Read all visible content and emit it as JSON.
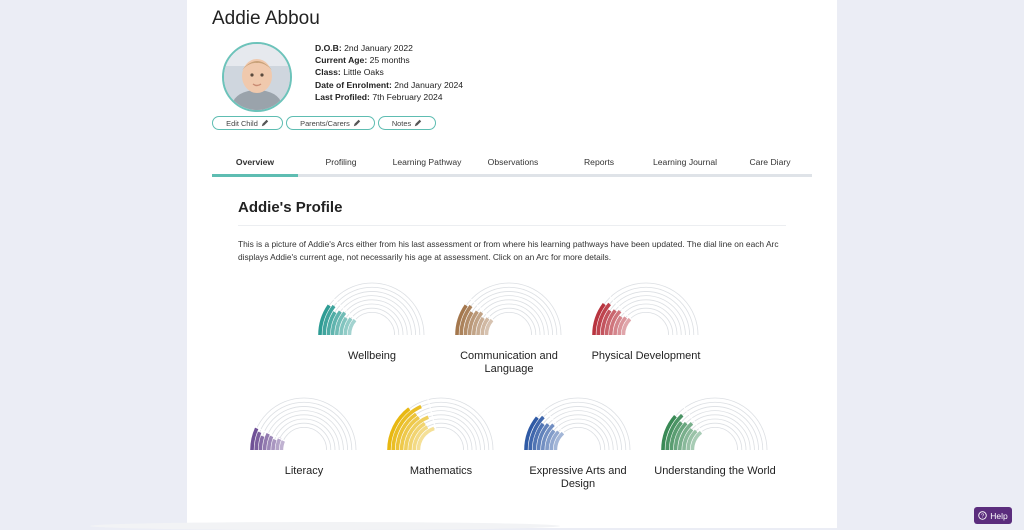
{
  "child": {
    "name": "Addie Abbou",
    "dob_label": "D.O.B:",
    "dob": "2nd January 2022",
    "age_label": "Current Age:",
    "age": "25 months",
    "class_label": "Class:",
    "class": "Little Oaks",
    "enrolment_label": "Date of Enrolment:",
    "enrolment": "2nd January 2024",
    "profiled_label": "Last Profiled:",
    "profiled": "7th February 2024"
  },
  "actions": {
    "edit_child": "Edit Child",
    "parents_carers": "Parents/Carers",
    "notes": "Notes"
  },
  "tabs": [
    "Overview",
    "Profiling",
    "Learning Pathway",
    "Observations",
    "Reports",
    "Learning Journal",
    "Care Diary"
  ],
  "active_tab": "Overview",
  "profile": {
    "title": "Addie's Profile",
    "description": "This is a picture of Addie's Arcs either from his last assessment or from where his learning pathways have been updated. The dial line on each Arc displays Addie's current age, not necessarily his age at assessment. Click on an Arc for more details."
  },
  "arcs": [
    {
      "label": "Wellbeing",
      "color": "#2e9c94",
      "progress": 0.24
    },
    {
      "label": "Communication and Language",
      "color": "#a4774d",
      "progress": 0.24
    },
    {
      "label": "Physical Development",
      "color": "#b8343f",
      "progress": 0.26
    },
    {
      "label": "Literacy",
      "color": "#6f5096",
      "progress": 0.14
    },
    {
      "label": "Mathematics",
      "color": "#e8b812",
      "progress": 0.42
    },
    {
      "label": "Expressive Arts and Design",
      "color": "#2f5aa5",
      "progress": 0.28
    },
    {
      "label": "Understanding the World",
      "color": "#3a8a56",
      "progress": 0.3
    }
  ],
  "help": {
    "label": "Help",
    "icon": "help-circle-icon"
  }
}
